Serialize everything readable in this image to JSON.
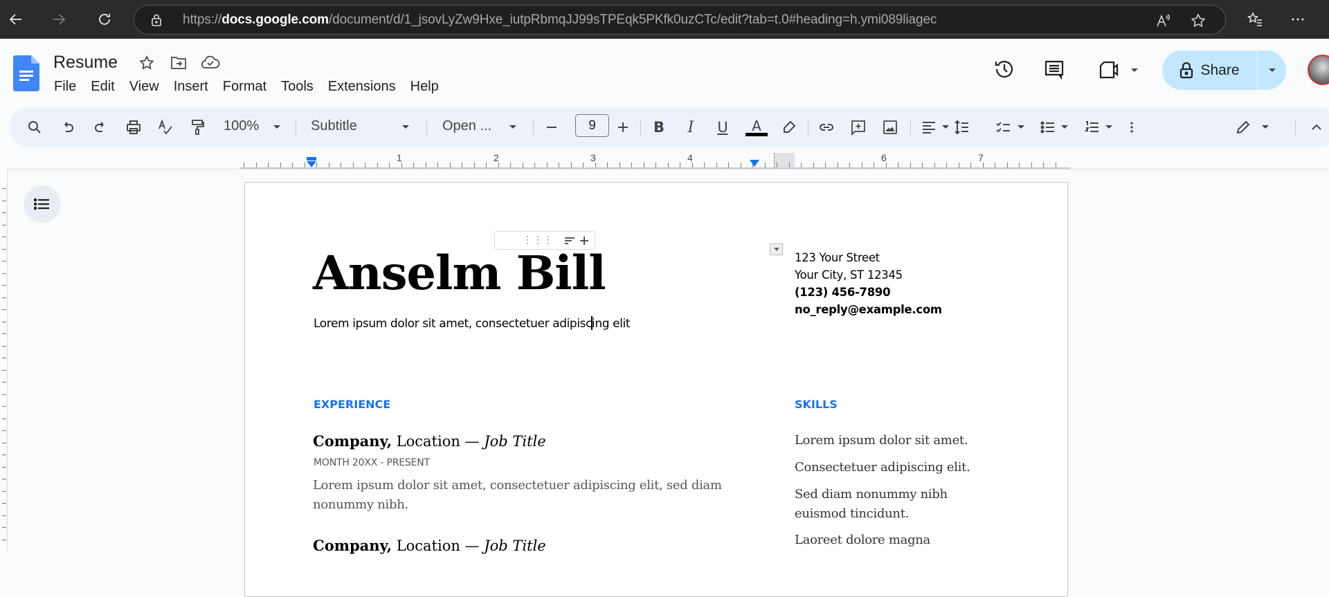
{
  "browser": {
    "url_prefix": "https://",
    "url_domain": "docs.google.com",
    "url_path": "/document/d/1_jsovLyZw9Hxe_iutpRbmqJJ99sTPEqk5PKfk0uzCTc/edit?tab=t.0#heading=h.ymi089liagec",
    "icons": [
      "back-icon",
      "forward-icon",
      "reload-icon",
      "lock-icon",
      "read-aloud-icon",
      "favorite-star-icon",
      "favorites-list-icon",
      "more-icon"
    ]
  },
  "header": {
    "doc_title": "Resume",
    "menus": [
      "File",
      "Edit",
      "View",
      "Insert",
      "Format",
      "Tools",
      "Extensions",
      "Help"
    ],
    "share_label": "Share"
  },
  "toolbar": {
    "zoom": "100%",
    "style": "Subtitle",
    "font": "Open ...",
    "font_size": "9",
    "accent_color": "#1a73e8",
    "share_bg": "#c2e7ff"
  },
  "ruler": {
    "numbers": [
      "1",
      "2",
      "3",
      "4",
      "6",
      "7"
    ]
  },
  "document": {
    "name": "Anselm Bill",
    "tagline_before_cursor": "Lorem ipsum dolor sit amet, consectetuer adipisc",
    "tagline_after_cursor": "ing elit",
    "contact": {
      "street": "123 Your Street",
      "city": "Your City, ST 12345",
      "phone": "(123) 456-7890",
      "email": "no_reply@example.com"
    },
    "experience_heading": "EXPERIENCE",
    "jobs": [
      {
        "company": "Company,",
        "location": " Location — ",
        "title": "Job Title",
        "dates": "MONTH 20XX - PRESENT",
        "description": "Lorem ipsum dolor sit amet, consectetuer adipiscing elit, sed diam nonummy nibh."
      },
      {
        "company": "Company,",
        "location": " Location — ",
        "title": "Job Title"
      }
    ],
    "skills_heading": "SKILLS",
    "skills": [
      "Lorem ipsum dolor sit amet.",
      "Consectetuer adipiscing elit.",
      "Sed diam nonummy nibh euismod tincidunt.",
      "Laoreet dolore magna"
    ]
  }
}
